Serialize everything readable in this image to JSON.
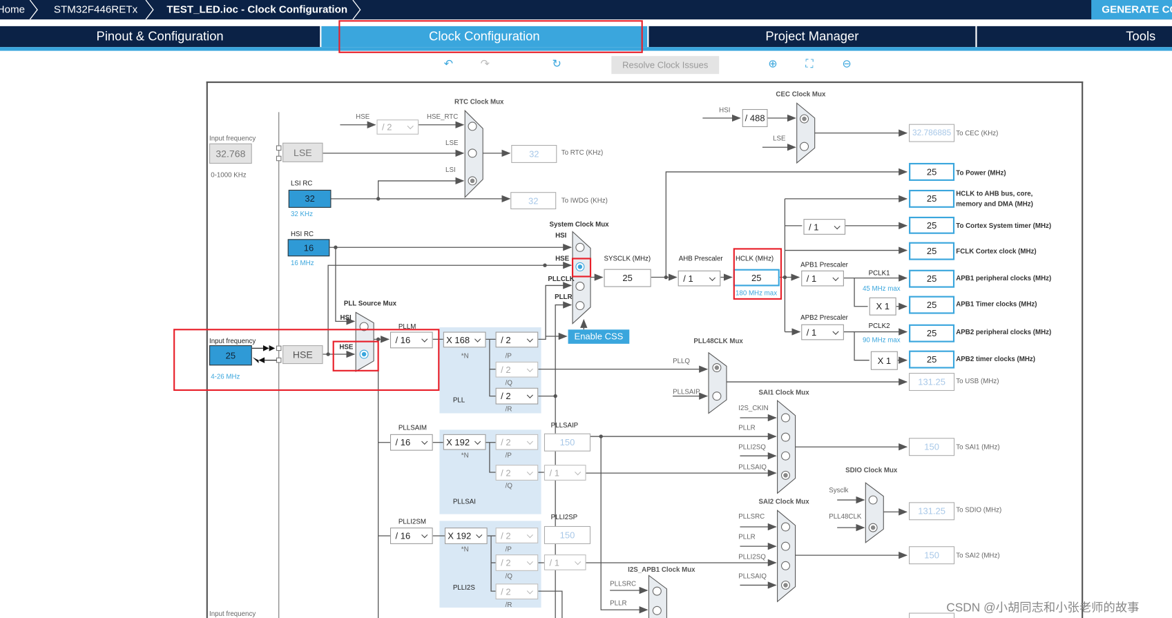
{
  "header": {
    "breadcrumbs": [
      "Home",
      "STM32F446RETx",
      "TEST_LED.ioc - Clock Configuration"
    ],
    "generate_label": "GENERATE CODE"
  },
  "tabs": [
    {
      "label": "Pinout & Configuration"
    },
    {
      "label": "Clock Configuration",
      "active": true
    },
    {
      "label": "Project Manager"
    },
    {
      "label": "Tools"
    }
  ],
  "toolbar": {
    "icons": [
      "undo-icon",
      "redo-icon",
      "reset-icon",
      "zoom-in-icon",
      "fit-icon",
      "zoom-out-icon"
    ],
    "resolve_label": "Resolve Clock Issues"
  },
  "colors": {
    "navy": "#0b2246",
    "accent": "#3aa6dd",
    "highlight": "#e8202a"
  },
  "d": {
    "lse_in": {
      "label": "Input frequency",
      "value": "32.768",
      "range": "0-1000 KHz",
      "name": "LSE"
    },
    "lsi": {
      "label": "LSI RC",
      "value": "32",
      "unit": "32 KHz"
    },
    "hsi": {
      "label": "HSI RC",
      "value": "16",
      "unit": "16 MHz"
    },
    "hse_in": {
      "label": "Input frequency",
      "value": "25",
      "range": "4-26 MHz",
      "name": "HSE"
    },
    "rtc": {
      "title": "RTC Clock Mux",
      "hse": "HSE",
      "div": "/ 2",
      "hse_rtc": "HSE_RTC",
      "lse": "LSE",
      "lsi": "LSI",
      "rtc_value": "32",
      "rtc_label": "To RTC (KHz)",
      "iwdg_value": "32",
      "iwdg_label": "To IWDG (KHz)"
    },
    "sysmux": {
      "title": "System Clock Mux",
      "hsi": "HSI",
      "hse": "HSE",
      "pllclk": "PLLCLK",
      "pllr": "PLLR",
      "selected": "HSE",
      "css": "Enable CSS"
    },
    "sysclk": {
      "label": "SYSCLK (MHz)",
      "value": "25"
    },
    "ahb": {
      "label": "AHB Prescaler",
      "value": "/ 1"
    },
    "hclk": {
      "label": "HCLK (MHz)",
      "value": "25",
      "max": "180 MHz max"
    },
    "apb1": {
      "label": "APB1 Prescaler",
      "value": "/ 1",
      "pclk": "PCLK1",
      "max": "45 MHz max",
      "timer_mul": "X 1"
    },
    "apb2": {
      "label": "APB2 Prescaler",
      "value": "/ 1",
      "pclk": "PCLK2",
      "max": "90 MHz max",
      "timer_mul": "X 1"
    },
    "cortex_div": "/ 1",
    "cec": {
      "title": "CEC Clock Mux",
      "hsi": "HSI",
      "div": "/ 488",
      "lse": "LSE",
      "value": "32.786885",
      "label": "To CEC (KHz)"
    },
    "outputs": [
      {
        "value": "25",
        "label": "To Power (MHz)"
      },
      {
        "value": "25",
        "label": "HCLK to AHB bus, core,",
        "label2": "memory and DMA (MHz)"
      },
      {
        "value": "25",
        "label": "To Cortex System timer (MHz)"
      },
      {
        "value": "25",
        "label": "FCLK Cortex clock (MHz)"
      },
      {
        "value": "25",
        "label": "APB1 peripheral clocks (MHz)"
      },
      {
        "value": "25",
        "label": "APB1 Timer clocks (MHz)"
      },
      {
        "value": "25",
        "label": "APB2 peripheral clocks (MHz)"
      },
      {
        "value": "25",
        "label": "APB2 timer clocks (MHz)"
      }
    ],
    "usb": {
      "value": "131.25",
      "label": "To USB (MHz)"
    },
    "pllsrc": {
      "title": "PLL Source Mux",
      "hsi": "HSI",
      "hse": "HSE",
      "selected": "HSE"
    },
    "pll": {
      "m_label": "PLLM",
      "m": "/ 16",
      "n": "X 168",
      "n_label": "*N",
      "p": "/ 2",
      "p_label": "/P",
      "q": "/ 2",
      "q_label": "/Q",
      "r": "/ 2",
      "r_label": "/R",
      "name": "PLL"
    },
    "pll48": {
      "title": "PLL48CLK Mux",
      "pllq": "PLLQ",
      "pllsaip": "PLLSAIP"
    },
    "sai1": {
      "title": "SAI1 Clock Mux",
      "inputs": [
        "I2S_CKIN",
        "PLLR",
        "PLLI2SQ",
        "PLLSAIQ"
      ],
      "value": "150",
      "label": "To SAI1 (MHz)"
    },
    "pllsai": {
      "m_label": "PLLSAIM",
      "m": "/ 16",
      "n": "X 192",
      "n_label": "*N",
      "p": "/ 2",
      "p_label": "/P",
      "q": "/ 2",
      "q_label": "/Q",
      "name": "PLLSAI",
      "p_out_label": "PLLSAIP",
      "p_out": "150",
      "q_div": "/ 1"
    },
    "sdio": {
      "title": "SDIO Clock Mux",
      "inputs": [
        "Sysclk",
        "PLL48CLK"
      ],
      "value": "131.25",
      "label": "To SDIO (MHz)"
    },
    "sai2": {
      "title": "SAI2 Clock Mux",
      "inputs": [
        "PLLSRC",
        "PLLR",
        "PLLI2SQ",
        "PLLSAIQ"
      ],
      "value": "150",
      "label": "To SAI2 (MHz)"
    },
    "plli2s": {
      "m_label": "PLLI2SM",
      "m": "/ 16",
      "n": "X 192",
      "n_label": "*N",
      "p": "/ 2",
      "p_label": "/P",
      "q": "/ 2",
      "q_label": "/Q",
      "r": "/ 2",
      "r_label": "/R",
      "name": "PLLI2S",
      "p_out_label": "PLLI2SP",
      "p_out": "150",
      "q_div": "/ 1"
    },
    "i2s_apb1": {
      "title": "I2S_APB1 Clock Mux",
      "inputs": [
        "PLLSRC",
        "PLLR"
      ]
    },
    "bottom_label": "Input frequency"
  },
  "watermark": "CSDN @小胡同志和小张老师的故事"
}
